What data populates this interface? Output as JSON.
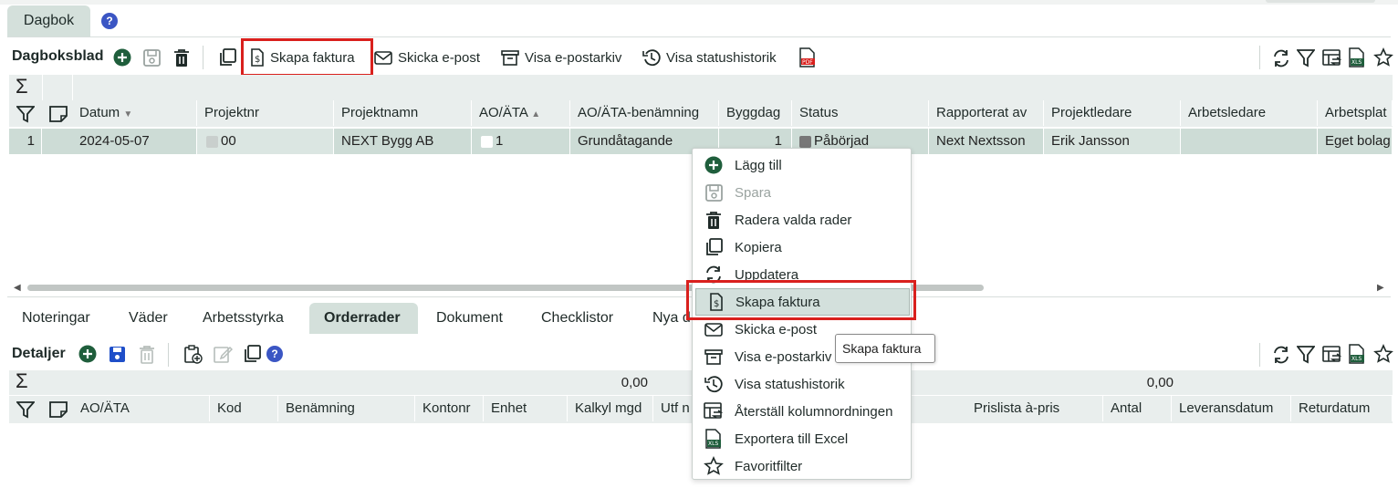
{
  "app": {
    "tab_label": "Dagbok",
    "help_icon": "?"
  },
  "toolbar": {
    "title": "Dagboksblad",
    "create_invoice": "Skapa faktura",
    "send_email": "Skicka e-post",
    "show_email_archive": "Visa e-postarkiv",
    "show_status_history": "Visa statushistorik"
  },
  "grid": {
    "columns": [
      "Datum",
      "Projektnr",
      "Projektnamn",
      "AO/ÄTA",
      "AO/ÄTA-benämning",
      "Byggdag",
      "Status",
      "Rapporterat av",
      "Projektledare",
      "Arbetsledare",
      "Arbetsplat"
    ],
    "row": {
      "num": "1",
      "datum": "2024-05-07",
      "projektnr": "00",
      "projektnamn": "NEXT Bygg AB",
      "ao": "1",
      "benamning": "Grundåtagande",
      "byggdag": "1",
      "status": "Påbörjad",
      "rapporterat": "Next Nextsson",
      "projektledare": "Erik Jansson",
      "arbetsledare": "",
      "arbetsplats": "Eget bolag"
    }
  },
  "tabs": [
    "Noteringar",
    "Väder",
    "Arbetsstyrka",
    "Orderrader",
    "Dokument",
    "Checklistor",
    "Nya d"
  ],
  "details": {
    "title": "Detaljer",
    "sum_values": [
      "0,00",
      "0,00"
    ],
    "columns": [
      "AO/ÄTA",
      "Kod",
      "Benämning",
      "Kontonr",
      "Enhet",
      "Kalkyl mgd",
      "Utf n",
      "Prislista à-pris",
      "Antal",
      "Leveransdatum",
      "Returdatum"
    ]
  },
  "context_menu": {
    "items": [
      {
        "label": "Lägg till",
        "icon": "plus-circle-icon",
        "disabled": false
      },
      {
        "label": "Spara",
        "icon": "save-icon",
        "disabled": true
      },
      {
        "label": "Radera valda rader",
        "icon": "trash-icon",
        "disabled": false
      },
      {
        "label": "Kopiera",
        "icon": "copy-icon",
        "disabled": false
      },
      {
        "label": "Uppdatera",
        "icon": "refresh-icon",
        "disabled": false
      },
      {
        "label": "Skapa faktura",
        "icon": "invoice-icon",
        "disabled": false,
        "highlight": true
      },
      {
        "label": "Skicka e-post",
        "icon": "mail-icon",
        "disabled": false
      },
      {
        "label": "Visa e-postarkiv",
        "icon": "archive-icon",
        "disabled": false
      },
      {
        "label": "Visa statushistorik",
        "icon": "history-icon",
        "disabled": false
      },
      {
        "label": "Återställ kolumnordningen",
        "icon": "reset-columns-icon",
        "disabled": false
      },
      {
        "label": "Exportera till Excel",
        "icon": "excel-icon",
        "disabled": false
      },
      {
        "label": "Favoritfilter",
        "icon": "star-icon",
        "disabled": false
      }
    ]
  },
  "tooltip": "Skapa faktura",
  "colors": {
    "accent_green": "#1f5e3c",
    "highlight_red": "#d9201d",
    "selected_row": "#cddcd6",
    "blue": "#1f4fc9"
  }
}
